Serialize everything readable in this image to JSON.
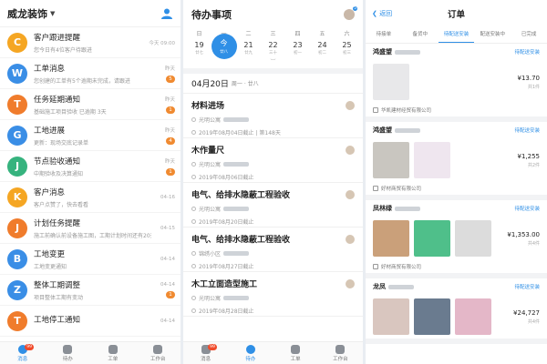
{
  "messages_panel": {
    "title": "威龙装饰",
    "items": [
      {
        "title": "客户跟进提醒",
        "subtitle": "您今日有4位客户待跟进",
        "date": "今天 09:00",
        "badge": "",
        "color": "#f5a623",
        "glyph": "C"
      },
      {
        "title": "工单消息",
        "subtitle": "您创建的工单有5个逾期未完成，请跟进",
        "date": "昨天",
        "badge": "5",
        "color": "#3a8ee6",
        "glyph": "W"
      },
      {
        "title": "任务延期通知",
        "subtitle": "基础施工项目验收 已逾期 3天",
        "date": "昨天",
        "badge": "1",
        "color": "#f07c2c",
        "glyph": "T"
      },
      {
        "title": "工地进展",
        "subtitle": "更新：现场交底记录单",
        "date": "昨天",
        "badge": "4",
        "color": "#3a8ee6",
        "glyph": "G"
      },
      {
        "title": "节点验收通知",
        "subtitle": "中期验收及决算通知",
        "date": "昨天",
        "badge": "1",
        "color": "#36b37e",
        "glyph": "J"
      },
      {
        "title": "客户消息",
        "subtitle": "客户点赞了，快去看看",
        "date": "04-16",
        "badge": "",
        "color": "#f5a623",
        "glyph": "K"
      },
      {
        "title": "计划任务提醒",
        "subtitle": "施工前确认前设备施工图，工期计划时间还有20天",
        "date": "04-15",
        "badge": "",
        "color": "#f07c2c",
        "glyph": "J"
      },
      {
        "title": "工地变更",
        "subtitle": "工地变更通知",
        "date": "04-14",
        "badge": "",
        "color": "#3a8ee6",
        "glyph": "B"
      },
      {
        "title": "整体工期调整",
        "subtitle": "项目整体工期有变动",
        "date": "04-14",
        "badge": "1",
        "color": "#3a8ee6",
        "glyph": "Z"
      },
      {
        "title": "工地停工通知",
        "subtitle": "",
        "date": "04-14",
        "badge": "",
        "color": "#f07c2c",
        "glyph": "T"
      }
    ],
    "tabbar": [
      {
        "label": "消息",
        "badge": "99",
        "active": true
      },
      {
        "label": "待办",
        "badge": "",
        "active": false
      },
      {
        "label": "工单",
        "badge": "",
        "active": false
      },
      {
        "label": "工作台",
        "badge": "",
        "active": false
      }
    ]
  },
  "todo_panel": {
    "title": "待办事项",
    "avatar_badge": "5",
    "week": [
      {
        "weekday": "日",
        "num": "19",
        "lunar": "廿七",
        "today": false
      },
      {
        "weekday": "一",
        "num": "今",
        "lunar": "廿八",
        "today": true
      },
      {
        "weekday": "二",
        "num": "21",
        "lunar": "廿九",
        "today": false
      },
      {
        "weekday": "三",
        "num": "22",
        "lunar": "三十",
        "today": false
      },
      {
        "weekday": "四",
        "num": "23",
        "lunar": "初一",
        "today": false
      },
      {
        "weekday": "五",
        "num": "24",
        "lunar": "初二",
        "today": false
      },
      {
        "weekday": "六",
        "num": "25",
        "lunar": "初三",
        "today": false
      }
    ],
    "date_header": "04月20日",
    "date_weekday": "周一 · 廿八",
    "tasks": [
      {
        "title": "材料进场",
        "location": "光明公寓",
        "deadline": "2019年08月04日截止 | 第148天"
      },
      {
        "title": "木作量尺",
        "location": "光明公寓",
        "deadline": "2019年08月06日截止"
      },
      {
        "title": "电气、给排水隐蔽工程验收",
        "location": "光明公寓",
        "deadline": "2019年08月20日截止"
      },
      {
        "title": "电气、给排水隐蔽工程验收",
        "location": "锦绣小区",
        "deadline": "2019年08月27日截止"
      },
      {
        "title": "木工立面造型施工",
        "location": "光明公寓",
        "deadline": "2019年08月28日截止"
      }
    ],
    "tabbar": [
      {
        "label": "消息",
        "badge": "99",
        "active": false
      },
      {
        "label": "待办",
        "badge": "",
        "active": true
      },
      {
        "label": "工单",
        "badge": "",
        "active": false
      },
      {
        "label": "工作台",
        "badge": "",
        "active": false
      }
    ]
  },
  "order_panel": {
    "back": "返回",
    "title": "订单",
    "tabs": [
      {
        "label": "待接单",
        "active": false
      },
      {
        "label": "备货中",
        "active": false
      },
      {
        "label": "待配送安装",
        "active": true
      },
      {
        "label": "配送安装中",
        "active": false
      },
      {
        "label": "已完成",
        "active": false
      }
    ],
    "orders": [
      {
        "name": "鸿盛望",
        "status": "待配送安装",
        "price": "¥13.70",
        "count": "共1件",
        "shop": "华凯建材经贸有限公司",
        "thumbs": [
          "#e8e8ea"
        ]
      },
      {
        "name": "鸿盛望",
        "status": "待配送安装",
        "price": "¥1,255",
        "count": "共2件",
        "shop": "好材商贸有限公司",
        "thumbs": [
          "#c9c6c0",
          "#efe6ef"
        ]
      },
      {
        "name": "凤林绿",
        "status": "待配送安装",
        "price": "¥1,353.00",
        "count": "共4件",
        "shop": "好材商贸有限公司",
        "thumbs": [
          "#caa07a",
          "#4fbf8a",
          "#dcdcdc"
        ]
      },
      {
        "name": "龙凤",
        "status": "待配送安装",
        "price": "¥24,727",
        "count": "共4件",
        "shop": "",
        "thumbs": [
          "#d9c6bf",
          "#6a7b8f",
          "#e4b7c8"
        ]
      }
    ]
  }
}
